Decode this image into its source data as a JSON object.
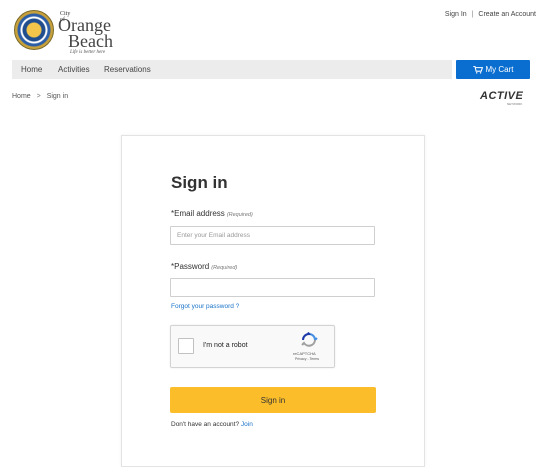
{
  "logo": {
    "city": "City of",
    "orange": "Orange",
    "beach": "Beach",
    "tagline": "Life is better here"
  },
  "top_links": {
    "sign_in": "Sign In",
    "separator": "|",
    "create_account": "Create an Account"
  },
  "nav": {
    "items": [
      "Home",
      "Activities",
      "Reservations"
    ],
    "cart_label": "My Cart",
    "cart_color": "#0a6ed1"
  },
  "breadcrumb": {
    "home": "Home",
    "separator": ">",
    "current": "Sign in"
  },
  "brand": {
    "active": "ACTIVE",
    "active_sub": "NETWORK"
  },
  "form": {
    "title": "Sign in",
    "email_label": "*Email address",
    "email_required": "(Required)",
    "email_placeholder": "Enter your Email address",
    "email_value": "",
    "password_label": "*Password",
    "password_required": "(Required)",
    "password_value": "",
    "forgot_link": "Forgot your password ?",
    "captcha_text": "I'm not a robot",
    "captcha_brand": "reCAPTCHA",
    "captcha_links": "Privacy - Terms",
    "submit_label": "Sign in",
    "submit_color": "#fbbd2a",
    "no_account_text": "Don't have an account?",
    "join_link": "Join"
  }
}
